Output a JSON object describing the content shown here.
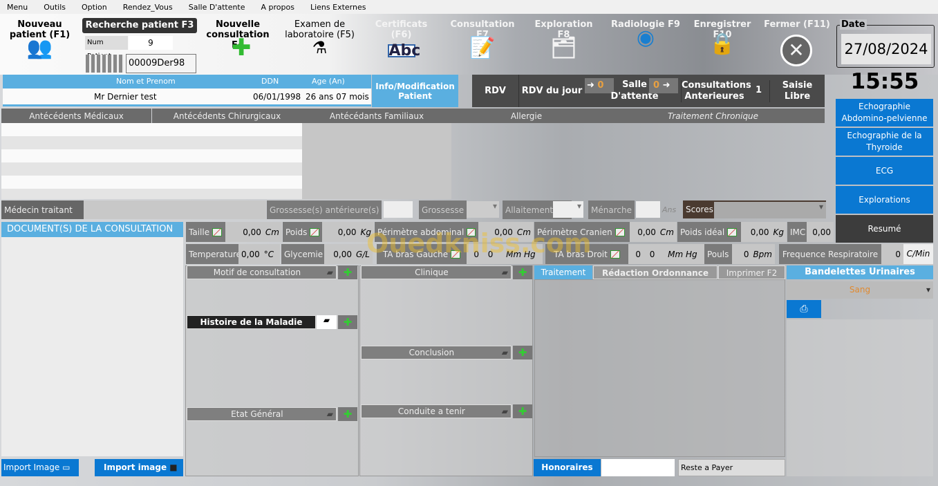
{
  "menu": [
    "Menu",
    "Outils",
    "Option",
    "Rendez_Vous",
    "Salle D'attente",
    "A propos",
    "Liens Externes"
  ],
  "toolbar": {
    "new_patient": "Nouveau patient (F1)",
    "search_patient": "Recherche patient F3",
    "num_patient_label": "Num Patient",
    "num_patient_value": "9",
    "barcode_value": "00009Der98",
    "new_consultation": "Nouvelle consultation F4",
    "lab_exam": "Examen de laboratoire (F5)",
    "certificats": "Certificats (F6)",
    "consultation": "Consultation F7",
    "exploration": "Exploration F8",
    "radiologie": "Radiologie F9",
    "enregistrer": "Enregistrer F10",
    "fermer": "Fermer (F11)"
  },
  "date": {
    "label": "Date",
    "value": "27/08/2024",
    "time": "15:55"
  },
  "patient": {
    "col_name": "Nom et Prenom",
    "col_ddn": "DDN",
    "col_age": "Age (An)",
    "name": "Mr Dernier test",
    "ddn": "06/01/1998",
    "age": "26 ans 07 mois",
    "info_button": "Info/Modification Patient"
  },
  "actions": {
    "rdv": "RDV",
    "rdv_jour": "RDV du jour",
    "rdv_count": "0",
    "salle": "Salle D'attente",
    "salle_count": "0",
    "consult_ant": "Consultations Anterieures",
    "consult_count": "1",
    "saisie": "Saisie Libre"
  },
  "right_buttons": [
    "Echographie Abdomino-pelvienne",
    "Echographie de la Thyroide",
    "ECG",
    "Explorations",
    "Resumé"
  ],
  "antecedents": [
    "Antécédents Médicaux",
    "Antécédents Chirurgicaux",
    "Antécédants Familiaux",
    "Allergie",
    "Traitement Chronique"
  ],
  "row2": {
    "medecin": "Médecin traitant",
    "grossesses_ant": "Grossesse(s) antérieure(s)",
    "grossesse": "Grossesse",
    "allaitement": "Allaitement",
    "menarche": "Ménarche",
    "ans": "Ans",
    "scores": "Scores"
  },
  "documents": {
    "title": "DOCUMENT(S) DE LA CONSULTATION",
    "import1": "Import Image",
    "import2": "Import image"
  },
  "vitals1": [
    {
      "label": "Taille",
      "value": "0,00",
      "unit": "Cm"
    },
    {
      "label": "Poids",
      "value": "0,00",
      "unit": "Kg"
    },
    {
      "label": "Périmètre abdominal",
      "value": "0,00",
      "unit": "Cm"
    },
    {
      "label": "Périmètre Cranien",
      "value": "0,00",
      "unit": "Cm"
    },
    {
      "label": "Poids idéal",
      "value": "0,00",
      "unit": "Kg"
    },
    {
      "label": "IMC",
      "value": "0,00",
      "unit": ""
    }
  ],
  "vitals2": {
    "temp_label": "Temperature",
    "temp_value": "0,00",
    "temp_unit": "°C",
    "gly_label": "Glycemie",
    "gly_value": "0,00",
    "gly_unit": "G/L",
    "tag_label": "TA bras Gauche",
    "tag_v1": "0",
    "tag_v2": "0",
    "tag_unit": "Mm Hg",
    "tad_label": "TA bras Droit",
    "tad_v1": "0",
    "tad_v2": "0",
    "tad_unit": "Mm Hg",
    "pouls_label": "Pouls",
    "pouls_value": "0",
    "pouls_unit": "Bpm",
    "fr_label": "Frequence Respiratoire",
    "fr_value": "0",
    "fr_unit": "C/Min"
  },
  "sections": {
    "motif": "Motif de consultation",
    "histoire": "Histoire de la Maladie",
    "etat": "Etat Général",
    "clinique": "Clinique",
    "conclusion": "Conclusion",
    "conduite": "Conduite a tenir"
  },
  "treatment": {
    "tab1": "Traitement",
    "tab2": "Rédaction Ordonnance",
    "tab3": "Imprimer F2",
    "honoraires": "Honoraires",
    "reste": "Reste a Payer"
  },
  "bandelettes": {
    "title": "Bandelettes Urinaires",
    "selected": "Sang"
  },
  "watermark": "Ouedkniss.com"
}
